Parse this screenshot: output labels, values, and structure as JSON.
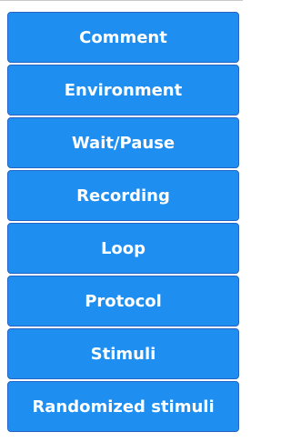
{
  "buttons": [
    {
      "label": "Comment"
    },
    {
      "label": "Environment"
    },
    {
      "label": "Wait/Pause"
    },
    {
      "label": "Recording"
    },
    {
      "label": "Loop"
    },
    {
      "label": "Protocol"
    },
    {
      "label": "Stimuli"
    },
    {
      "label": "Randomized stimuli"
    }
  ],
  "colors": {
    "button_fill": "#1e8ef0",
    "button_border": "#2563c4",
    "button_text": "#ffffff"
  }
}
